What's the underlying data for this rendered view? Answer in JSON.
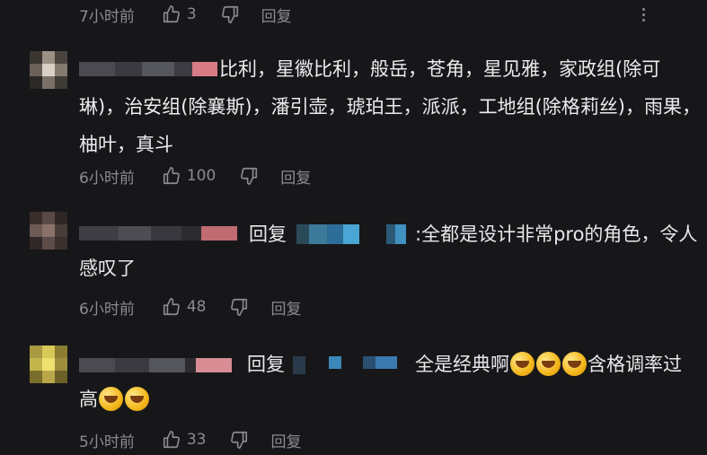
{
  "top_meta": {
    "time": "7小时前",
    "likes": "3",
    "reply_label": "回复"
  },
  "comments": [
    {
      "text": "比利，星徽比利，般岳，苍角，星见雅，家政组(除可琳)，治安组(除襄斯)，潘引壶，琥珀王，派派，工地组(除格莉丝)，雨果，柚叶，真斗",
      "time": "6小时前",
      "likes": "100",
      "reply_label": "回复"
    },
    {
      "reply_prefix": "回复",
      "text_line1": ":全都是设计非常pro的角色，令人",
      "text_line2": "感叹了",
      "time": "6小时前",
      "likes": "48",
      "reply_label": "回复"
    },
    {
      "reply_prefix": "回复",
      "text_a": "全是经典啊",
      "text_b": "含格调率过",
      "text_c": "高",
      "time": "5小时前",
      "likes": "33",
      "reply_label": "回复"
    }
  ],
  "icons": {
    "like": "thumbs-up-icon",
    "dislike": "thumbs-down-icon",
    "more": "more-vertical-icon",
    "emoji": "crying-laughing-emoji"
  },
  "colors": {
    "background": "#17171a",
    "text": "#ececee",
    "meta": "#8b8b90"
  }
}
